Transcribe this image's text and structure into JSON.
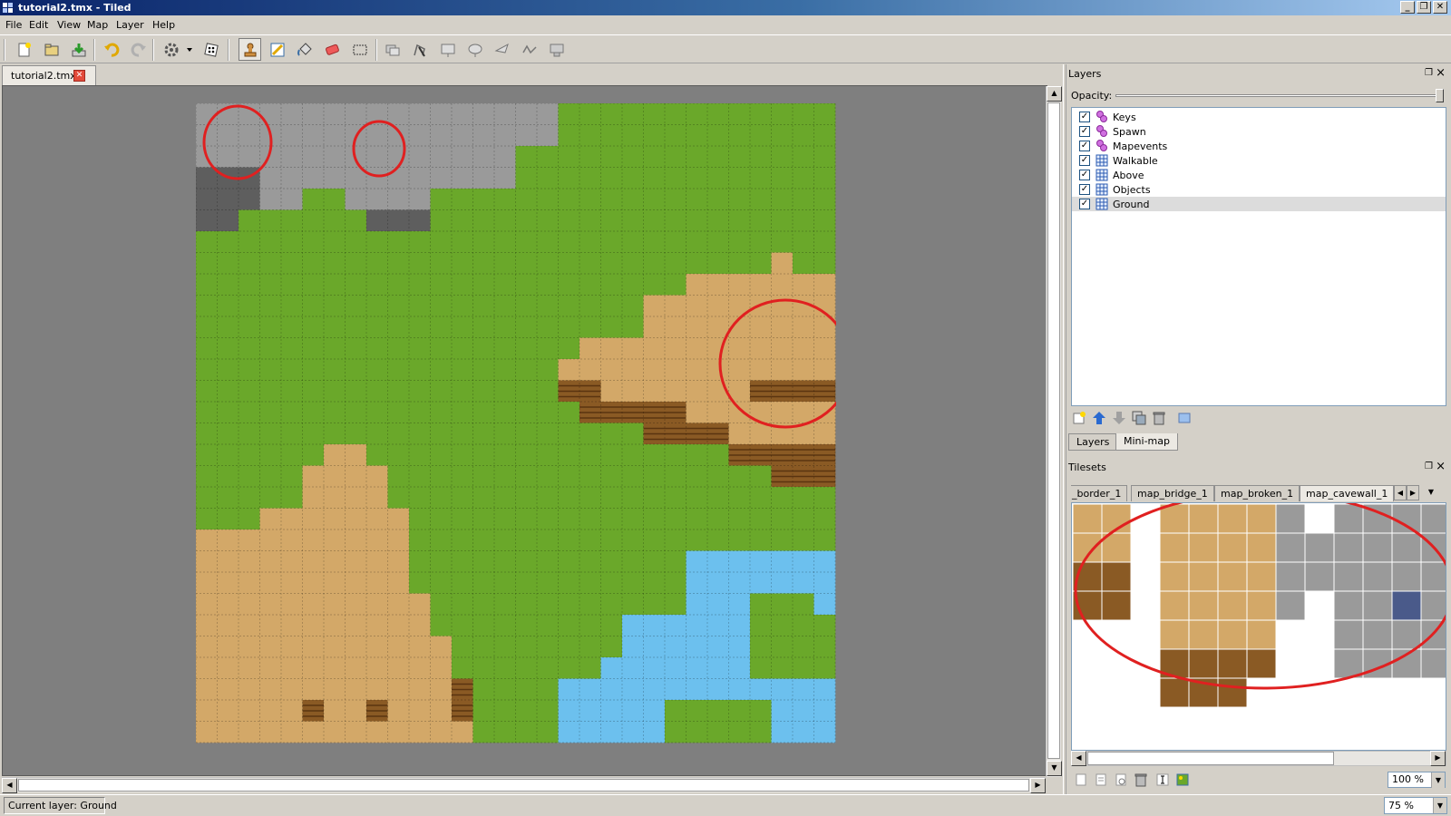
{
  "window": {
    "title": "tutorial2.tmx - Tiled",
    "controls": [
      "_",
      "❐",
      "✕"
    ]
  },
  "menubar": {
    "items": [
      "File",
      "Edit",
      "View",
      "Map",
      "Layer",
      "Help"
    ]
  },
  "toolbar": {
    "buttons": [
      "new-icon",
      "open-icon",
      "save-icon",
      "undo-icon",
      "redo-icon",
      "commands-icon",
      "random-mode-icon",
      "stamp-brush-icon",
      "terrain-brush-icon",
      "bucket-fill-icon",
      "eraser-icon",
      "rect-select-icon",
      "select-objects-icon",
      "edit-polygons-icon",
      "insert-rectangle-icon",
      "insert-ellipse-icon",
      "insert-polygon-icon",
      "insert-polyline-icon",
      "insert-tile-icon"
    ]
  },
  "document": {
    "tab_label": "tutorial2.tmx",
    "close_label": "✕"
  },
  "status": {
    "current_layer": "Current layer: Ground",
    "zoom": "75 %"
  },
  "layers_panel": {
    "title": "Layers",
    "opacity_label": "Opacity:",
    "opacity": 1.0,
    "layers": [
      {
        "name": "Keys",
        "type": "object",
        "visible": true,
        "selected": false
      },
      {
        "name": "Spawn",
        "type": "object",
        "visible": true,
        "selected": false
      },
      {
        "name": "Mapevents",
        "type": "object",
        "visible": true,
        "selected": false
      },
      {
        "name": "Walkable",
        "type": "tile",
        "visible": true,
        "selected": false
      },
      {
        "name": "Above",
        "type": "tile",
        "visible": true,
        "selected": false
      },
      {
        "name": "Objects",
        "type": "tile",
        "visible": true,
        "selected": false
      },
      {
        "name": "Ground",
        "type": "tile",
        "visible": true,
        "selected": true
      }
    ],
    "tabs": [
      "Layers",
      "Mini-map"
    ]
  },
  "tilesets_panel": {
    "title": "Tilesets",
    "tabs": [
      "_border_1",
      "map_bridge_1",
      "map_broken_1",
      "map_cavewall_1"
    ],
    "zoom": "100 %"
  },
  "colors": {
    "grass": "#6aa82a",
    "rock": "#9a9a9a",
    "sand": "#d3a868",
    "cliff": "#8a5a24",
    "water": "#6cc0ee",
    "annotation": "#e02020"
  }
}
